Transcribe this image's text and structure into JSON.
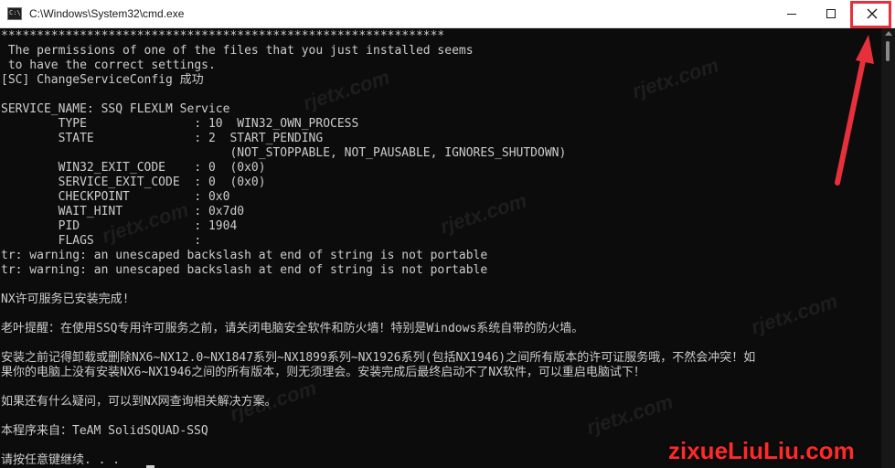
{
  "window": {
    "title": "C:\\Windows\\System32\\cmd.exe",
    "app_icon_text": "C:\\",
    "minimize_label": "",
    "maximize_label": "",
    "close_label": ""
  },
  "console": {
    "lines": [
      "**************************************************************",
      " The permissions of one of the files that you just installed seems",
      " to have the correct settings.",
      "[SC] ChangeServiceConfig 成功",
      "",
      "SERVICE_NAME: SSQ FLEXLM Service",
      "        TYPE               : 10  WIN32_OWN_PROCESS",
      "        STATE              : 2  START_PENDING",
      "                                (NOT_STOPPABLE, NOT_PAUSABLE, IGNORES_SHUTDOWN)",
      "        WIN32_EXIT_CODE    : 0  (0x0)",
      "        SERVICE_EXIT_CODE  : 0  (0x0)",
      "        CHECKPOINT         : 0x0",
      "        WAIT_HINT          : 0x7d0",
      "        PID                : 1904",
      "        FLAGS              :",
      "tr: warning: an unescaped backslash at end of string is not portable",
      "tr: warning: an unescaped backslash at end of string is not portable",
      "",
      "NX许可服务已安装完成!",
      "",
      "老叶提醒：在使用SSQ专用许可服务之前，请关闭电脑安全软件和防火墙！特别是Windows系统自带的防火墙。",
      "",
      "安装之前记得卸载或删除NX6~NX12.0~NX1847系列~NX1899系列~NX1926系列(包括NX1946)之间所有版本的许可证服务哦，不然会冲突！如",
      "果你的电脑上没有安装NX6~NX1946之间的所有版本，则无须理会。安装完成后最终启动不了NX软件，可以重启电脑试下！",
      "",
      "如果还有什么疑问，可以到NX网查询相关解决方案。",
      "",
      "本程序来自：TeAM SolidSQUAD-SSQ",
      "",
      "请按任意键继续. . ."
    ]
  },
  "watermarks": {
    "diagonal": "rjetx.com",
    "site": "zixueLiuLiu.com"
  },
  "colors": {
    "console_bg": "#0c0c0c",
    "console_fg": "#cccccc",
    "highlight": "#e8303c",
    "site_watermark": "#ff2a2a"
  }
}
